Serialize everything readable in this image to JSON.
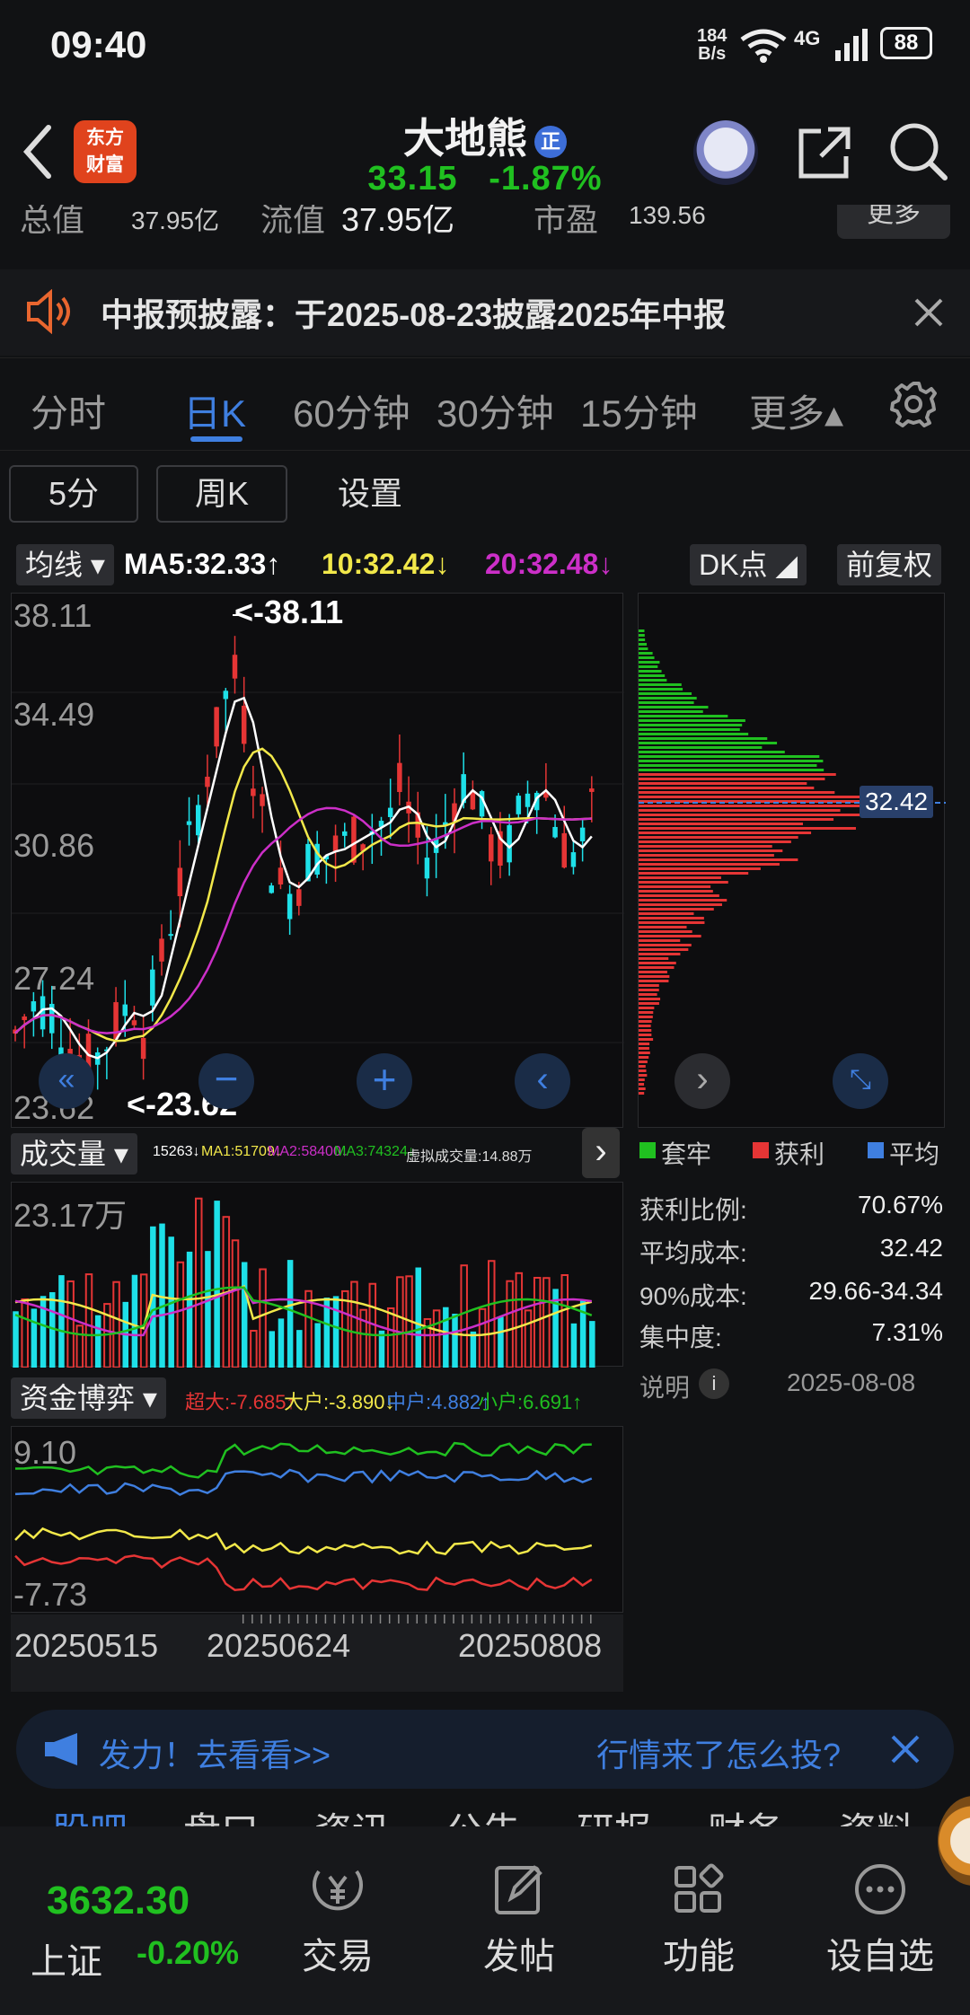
{
  "status": {
    "time": "09:40",
    "net_speed_value": "184",
    "net_speed_unit": "B/s",
    "network": "4G",
    "battery": "88"
  },
  "header": {
    "logo_line1": "东方",
    "logo_line2": "财富",
    "stock_name": "大地熊",
    "badge": "正",
    "price": "33.15",
    "change_pct": "-1.87%"
  },
  "info": {
    "total_cap_label": "总值",
    "total_cap_value": "37.95亿",
    "float_cap_label": "流值",
    "float_cap_value": "37.95亿",
    "pe_label": "市盈",
    "pe_value": "139.56",
    "more": "更多"
  },
  "notice": {
    "text": "中报预披露：于2025-08-23披露2025年中报"
  },
  "tabs": [
    {
      "label": "分时",
      "active": false
    },
    {
      "label": "日K",
      "active": true
    },
    {
      "label": "60分钟",
      "active": false
    },
    {
      "label": "30分钟",
      "active": false
    },
    {
      "label": "15分钟",
      "active": false
    },
    {
      "label": "更多▴",
      "active": false
    }
  ],
  "subbar": {
    "five_min": "5分",
    "week_k": "周K",
    "settings": "设置"
  },
  "ma_legend": {
    "selector": "均线",
    "ma5": "MA5:32.33↑",
    "ma10": "10:32.42↓",
    "ma20": "20:32.48↓",
    "dk": "DK点",
    "adjust": "前复权"
  },
  "kline": {
    "y_labels": [
      "38.11",
      "34.49",
      "30.86",
      "27.24",
      "23.62"
    ],
    "high_marker": "<-38.11",
    "low_marker": "<-23.62"
  },
  "chip": {
    "avg_cost_label": "32.42",
    "legend": [
      "套牢",
      "获利",
      "平均"
    ],
    "rows": [
      {
        "label": "获利比例:",
        "value": "70.67%"
      },
      {
        "label": "平均成本:",
        "value": "32.42"
      },
      {
        "label": "90%成本:",
        "value": "29.66-34.34"
      },
      {
        "label": "集中度:",
        "value": "7.31%"
      }
    ],
    "note": "说明",
    "date": "2025-08-08"
  },
  "volume": {
    "selector": "成交量",
    "v": "15263↓",
    "ma1": "MA1:51709↓",
    "ma2": "MA2:58400↓",
    "ma3": "MA3:74324↓",
    "virtual": "虚拟成交量:14.88万",
    "top_label": "23.17万"
  },
  "fund": {
    "selector": "资金博弈",
    "super": "超大:-7.685↑",
    "big": "大户:-3.890↓",
    "mid": "中户:4.882↑",
    "small": "小户:6.691↑",
    "top": "9.10",
    "bottom": "-7.73"
  },
  "dates": [
    "20250515",
    "20250624",
    "20250808"
  ],
  "ad": {
    "left": "发力！去看看>>",
    "right": "行情来了怎么投?"
  },
  "subtabs": [
    "股吧",
    "盘口",
    "资讯",
    "公告",
    "研报",
    "财务",
    "资料"
  ],
  "bottom": {
    "index_value": "3632.30",
    "index_name": "上证",
    "index_change": "-0.20%",
    "nav": [
      "交易",
      "发帖",
      "功能",
      "设自选"
    ]
  },
  "colors": {
    "up": "#e53535",
    "down": "#1ee0e8",
    "green": "#20c020",
    "accent": "#3f7fe0",
    "ma5": "#ffffff",
    "ma10": "#f2e84a",
    "ma20": "#cc2fc8"
  }
}
